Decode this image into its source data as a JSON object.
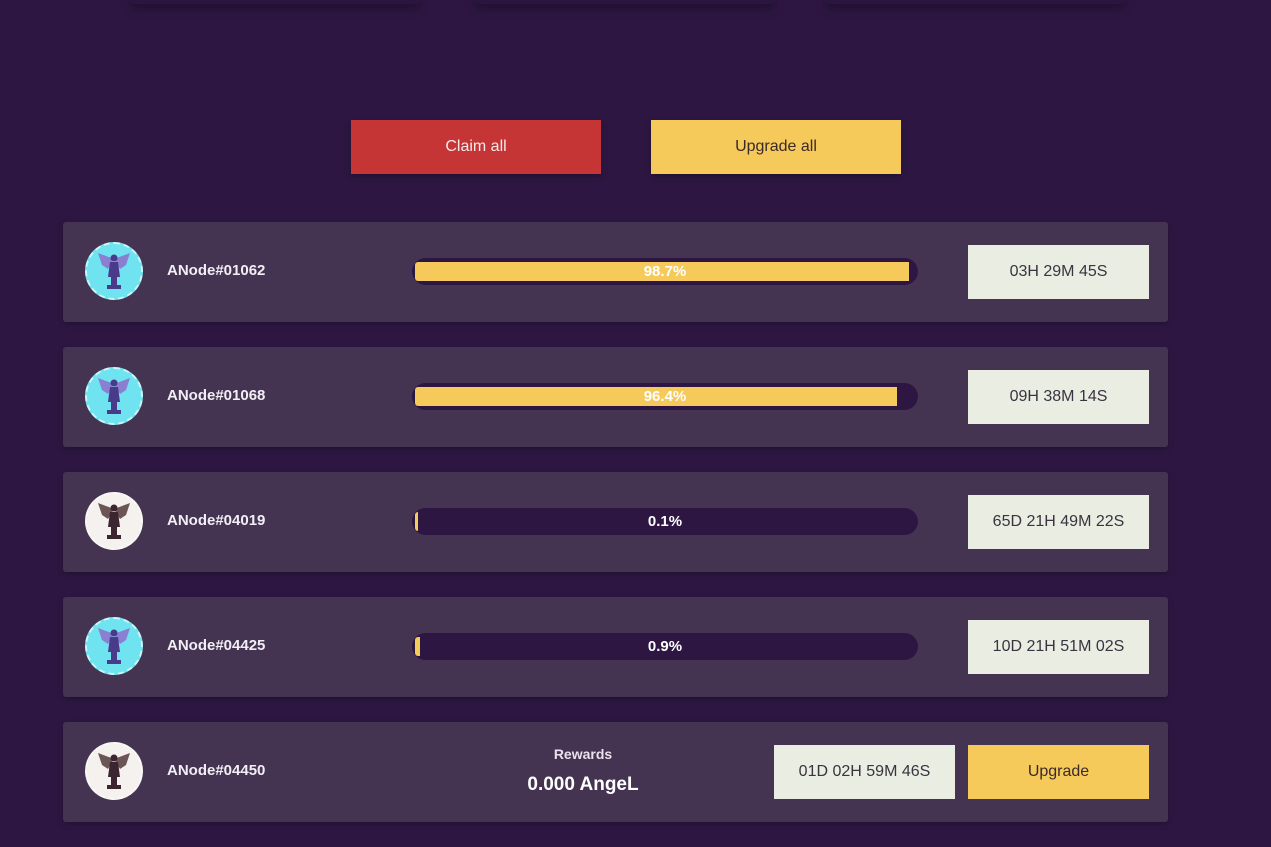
{
  "toolbar": {
    "claim_all_label": "Claim all",
    "upgrade_all_label": "Upgrade all"
  },
  "nodes": [
    {
      "name": "ANode#01062",
      "progress_label": "98.7%",
      "progress": 0.987,
      "timer": "03H 29M 45S",
      "avatar_color": "#6fe3ef"
    },
    {
      "name": "ANode#01068",
      "progress_label": "96.4%",
      "progress": 0.964,
      "timer": "09H 38M 14S",
      "avatar_color": "#6fe3ef"
    },
    {
      "name": "ANode#04019",
      "progress_label": "0.1%",
      "progress": 0.001,
      "timer": "65D 21H 49M 22S",
      "avatar_color": "#f4f1ee"
    },
    {
      "name": "ANode#04425",
      "progress_label": "0.9%",
      "progress": 0.009,
      "timer": "10D 21H 51M 02S",
      "avatar_color": "#6fe3ef"
    }
  ],
  "last_node": {
    "name": "ANode#04450",
    "rewards_label": "Rewards",
    "rewards_value": "0.000 AngeL",
    "timer": "01D 02H 59M 46S",
    "upgrade_label": "Upgrade",
    "avatar_color": "#f4f1ee"
  },
  "colors": {
    "background": "#2d1742",
    "card": "#453451",
    "accent_yellow": "#f5c95a",
    "accent_red": "#c63535"
  },
  "icons": {
    "avatar": "angel-statue-icon"
  }
}
